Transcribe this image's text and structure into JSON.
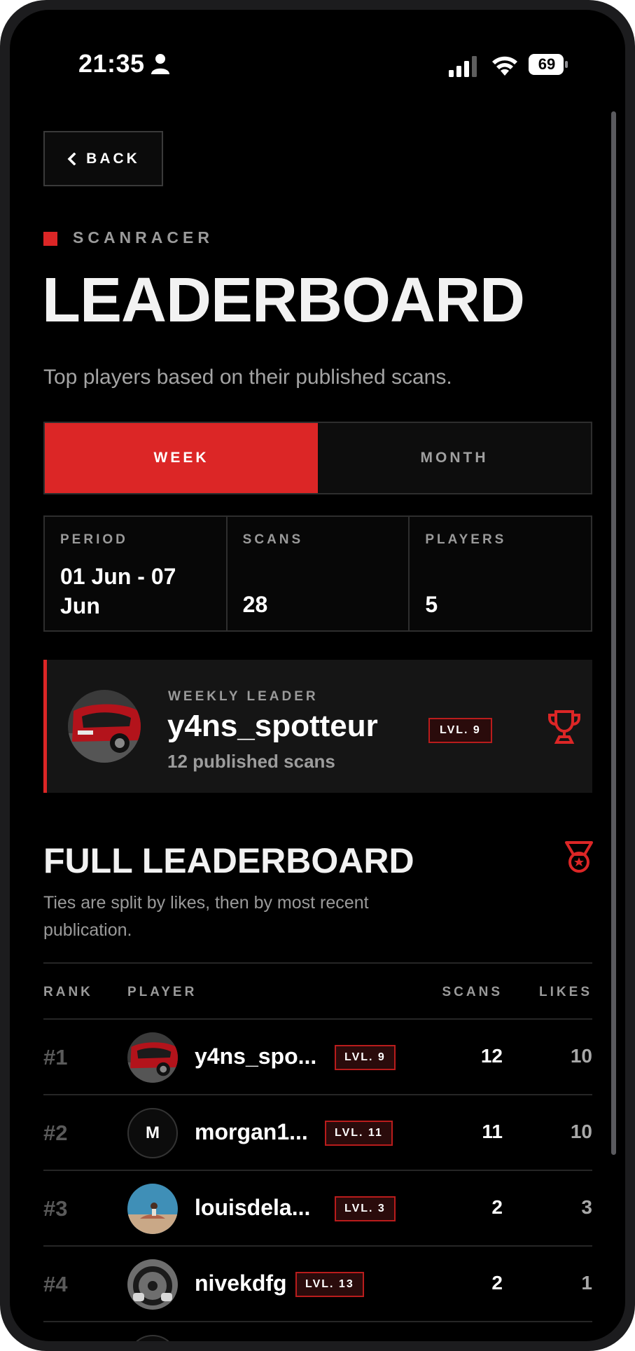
{
  "status_bar": {
    "time": "21:35",
    "battery": "69"
  },
  "nav": {
    "back_label": "BACK"
  },
  "header": {
    "eyebrow": "SCANRACER",
    "title": "LEADERBOARD",
    "subtitle": "Top players based on their published scans."
  },
  "tabs": [
    {
      "label": "WEEK",
      "active": true
    },
    {
      "label": "MONTH",
      "active": false
    }
  ],
  "stats": {
    "period_label": "PERIOD",
    "period_value": "01 Jun - 07 Jun",
    "scans_label": "SCANS",
    "scans_value": "28",
    "players_label": "PLAYERS",
    "players_value": "5"
  },
  "leader": {
    "tag": "WEEKLY LEADER",
    "name": "y4ns_spotteur",
    "level": "LVL. 9",
    "scans_text": "12 published scans"
  },
  "full": {
    "title": "FULL LEADERBOARD",
    "note": "Ties are split by likes, then by most recent publication.",
    "columns": {
      "rank": "RANK",
      "player": "PLAYER",
      "scans": "SCANS",
      "likes": "LIKES"
    },
    "rows": [
      {
        "rank": "#1",
        "name": "y4ns_spo...",
        "level": "LVL. 9",
        "scans": "12",
        "likes": "10",
        "avatar": "red-car-photo"
      },
      {
        "rank": "#2",
        "name": "morgan1...",
        "level": "LVL. 11",
        "scans": "11",
        "likes": "10",
        "avatar": "M"
      },
      {
        "rank": "#3",
        "name": "louisdela...",
        "level": "LVL. 3",
        "scans": "2",
        "likes": "3",
        "avatar": "beach-photo"
      },
      {
        "rank": "#4",
        "name": "nivekdfg",
        "level": "LVL. 13",
        "scans": "2",
        "likes": "1",
        "avatar": "steering-wheel-photo"
      }
    ]
  },
  "colors": {
    "accent": "#dc2626",
    "background": "#000000"
  }
}
